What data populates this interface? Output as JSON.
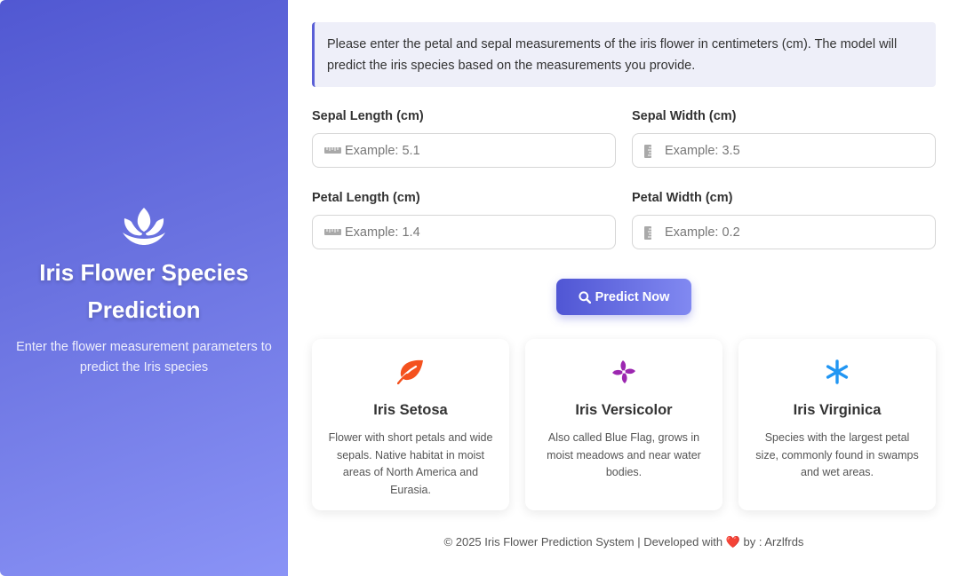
{
  "sidebar": {
    "title": "Iris Flower Species Prediction",
    "subtitle": "Enter the flower measurement parameters to predict the Iris species",
    "logo_icon": "lotus-icon"
  },
  "info_text": "Please enter the petal and sepal measurements of the iris flower in centimeters (cm). The model will predict the iris species based on the measurements you provide.",
  "fields": {
    "sepal_length": {
      "label": "Sepal Length (cm)",
      "placeholder": "Example: 5.1",
      "value": "",
      "icon": "ruler-horizontal-icon"
    },
    "sepal_width": {
      "label": "Sepal Width (cm)",
      "placeholder": "Example: 3.5",
      "value": "",
      "icon": "ruler-vertical-icon"
    },
    "petal_length": {
      "label": "Petal Length (cm)",
      "placeholder": "Example: 1.4",
      "value": "",
      "icon": "ruler-horizontal-icon"
    },
    "petal_width": {
      "label": "Petal Width (cm)",
      "placeholder": "Example: 0.2",
      "value": "",
      "icon": "ruler-vertical-icon"
    }
  },
  "predict_button": {
    "label": "Predict Now",
    "icon": "search-icon"
  },
  "species": [
    {
      "name": "Iris Setosa",
      "description": "Flower with short petals and wide sepals. Native habitat in moist areas of North America and Eurasia.",
      "icon": "leaf-icon",
      "color": "#f4511e"
    },
    {
      "name": "Iris Versicolor",
      "description": "Also called Blue Flag, grows in moist meadows and near water bodies.",
      "icon": "pinwheel-icon",
      "color": "#9c27b0"
    },
    {
      "name": "Iris Virginica",
      "description": "Species with the largest petal size, commonly found in swamps and wet areas.",
      "icon": "asterisk-icon",
      "color": "#2196f3"
    }
  ],
  "footer": {
    "text_before": "© 2025 Iris Flower Prediction System | Developed with",
    "heart": "❤️",
    "text_after": "by : Arzlfrds"
  },
  "colors": {
    "accent": "#5a5fd6",
    "gradient_start": "#5158d2",
    "gradient_end": "#8a93f6"
  }
}
